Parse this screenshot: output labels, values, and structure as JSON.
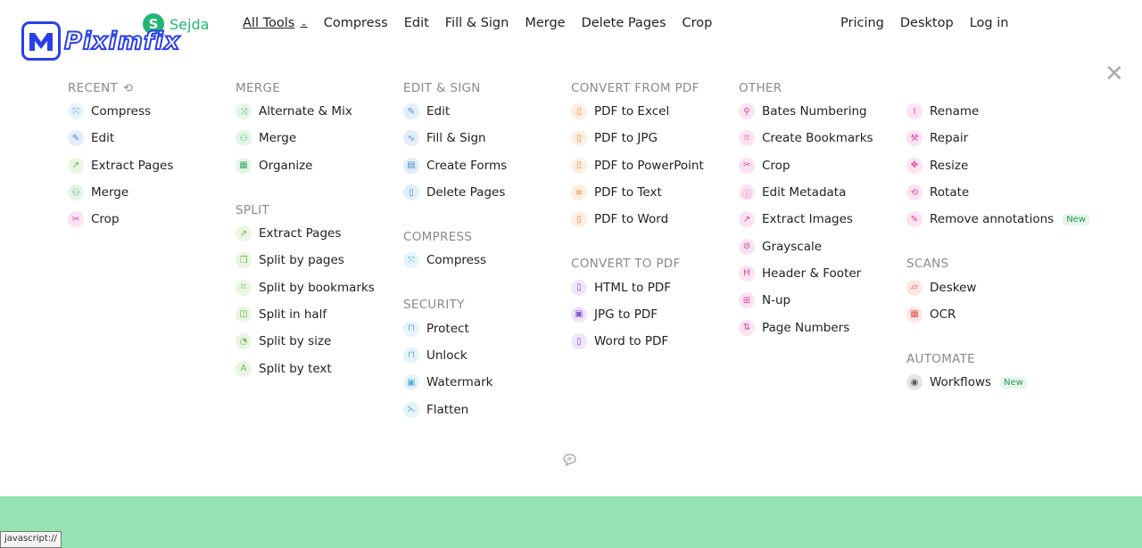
{
  "brand": {
    "sejda_letter": "S",
    "sejda_name": "Sejda",
    "piximfix": "Piximfix"
  },
  "nav": {
    "left": [
      "All Tools",
      "Compress",
      "Edit",
      "Fill & Sign",
      "Merge",
      "Delete Pages",
      "Crop"
    ],
    "right": [
      "Pricing",
      "Desktop",
      "Log in"
    ],
    "close": "✕"
  },
  "columns": [
    {
      "sections": [
        {
          "title": "RECENT",
          "items": [
            {
              "label": "Compress",
              "icon": "compress-icon",
              "glyph": "⤧",
              "color": "#e6f3fb",
              "fg": "#5aa9d6"
            },
            {
              "label": "Edit",
              "icon": "pencil-icon",
              "glyph": "✎",
              "color": "#e3eefb",
              "fg": "#4a8bd4"
            },
            {
              "label": "Extract Pages",
              "icon": "extract-icon",
              "glyph": "↗",
              "color": "#eaf6e3",
              "fg": "#6cb34a"
            },
            {
              "label": "Merge",
              "icon": "merge-icon",
              "glyph": "⚇",
              "color": "#e4f5ea",
              "fg": "#3fae6b"
            },
            {
              "label": "Crop",
              "icon": "crop-icon",
              "glyph": "✂",
              "color": "#fbe3f2",
              "fg": "#e0409b"
            }
          ]
        }
      ]
    },
    {
      "sections": [
        {
          "title": "MERGE",
          "items": [
            {
              "label": "Alternate & Mix",
              "icon": "shuffle-icon",
              "glyph": "⤨",
              "color": "#e4f5ea",
              "fg": "#3fae6b"
            },
            {
              "label": "Merge",
              "icon": "merge-icon",
              "glyph": "⚇",
              "color": "#e4f5ea",
              "fg": "#3fae6b"
            },
            {
              "label": "Organize",
              "icon": "grid-icon",
              "glyph": "▦",
              "color": "#e4f5ea",
              "fg": "#3fae6b"
            }
          ]
        },
        {
          "title": "SPLIT",
          "items": [
            {
              "label": "Extract Pages",
              "icon": "extract-icon",
              "glyph": "↗",
              "color": "#eaf6e3",
              "fg": "#6cb34a"
            },
            {
              "label": "Split by pages",
              "icon": "pages-icon",
              "glyph": "❐",
              "color": "#eaf6e3",
              "fg": "#6cb34a"
            },
            {
              "label": "Split by bookmarks",
              "icon": "bookmark-icon",
              "glyph": "⌑",
              "color": "#eaf6e3",
              "fg": "#6cb34a"
            },
            {
              "label": "Split in half",
              "icon": "half-icon",
              "glyph": "◫",
              "color": "#eaf6e3",
              "fg": "#6cb34a"
            },
            {
              "label": "Split by size",
              "icon": "size-icon",
              "glyph": "◔",
              "color": "#eaf6e3",
              "fg": "#6cb34a"
            },
            {
              "label": "Split by text",
              "icon": "text-icon",
              "glyph": "A",
              "color": "#eaf6e3",
              "fg": "#6cb34a"
            }
          ]
        }
      ]
    },
    {
      "sections": [
        {
          "title": "EDIT & SIGN",
          "items": [
            {
              "label": "Edit",
              "icon": "pencil-icon",
              "glyph": "✎",
              "color": "#e3eefb",
              "fg": "#4a8bd4"
            },
            {
              "label": "Fill & Sign",
              "icon": "signature-icon",
              "glyph": "∿",
              "color": "#e3eefb",
              "fg": "#4a8bd4"
            },
            {
              "label": "Create Forms",
              "icon": "form-icon",
              "glyph": "▤",
              "color": "#e3eefb",
              "fg": "#4a8bd4"
            },
            {
              "label": "Delete Pages",
              "icon": "trash-icon",
              "glyph": "▯",
              "color": "#e3eefb",
              "fg": "#4a8bd4"
            }
          ]
        },
        {
          "title": "COMPRESS",
          "items": [
            {
              "label": "Compress",
              "icon": "compress-icon",
              "glyph": "⤧",
              "color": "#e6f3fb",
              "fg": "#5aa9d6"
            }
          ]
        },
        {
          "title": "SECURITY",
          "items": [
            {
              "label": "Protect",
              "icon": "lock-icon",
              "glyph": "⊓",
              "color": "#e6f3fb",
              "fg": "#5aa9d6"
            },
            {
              "label": "Unlock",
              "icon": "unlock-icon",
              "glyph": "⊓",
              "color": "#e6f3fb",
              "fg": "#5aa9d6"
            },
            {
              "label": "Watermark",
              "icon": "watermark-icon",
              "glyph": "▣",
              "color": "#e6f3fb",
              "fg": "#5aa9d6"
            },
            {
              "label": "Flatten",
              "icon": "flatten-icon",
              "glyph": "⋋",
              "color": "#e6f3fb",
              "fg": "#5aa9d6"
            }
          ]
        }
      ]
    },
    {
      "sections": [
        {
          "title": "CONVERT FROM PDF",
          "items": [
            {
              "label": "PDF to Excel",
              "icon": "file-excel-icon",
              "glyph": "▯",
              "color": "#fdeee2",
              "fg": "#ef8a3a"
            },
            {
              "label": "PDF to JPG",
              "icon": "file-image-icon",
              "glyph": "▯",
              "color": "#fdeee2",
              "fg": "#ef8a3a"
            },
            {
              "label": "PDF to PowerPoint",
              "icon": "file-ppt-icon",
              "glyph": "▯",
              "color": "#fdeee2",
              "fg": "#ef8a3a"
            },
            {
              "label": "PDF to Text",
              "icon": "file-text-icon",
              "glyph": "≡",
              "color": "#fdeee2",
              "fg": "#ef8a3a"
            },
            {
              "label": "PDF to Word",
              "icon": "file-word-icon",
              "glyph": "▯",
              "color": "#fdeee2",
              "fg": "#ef8a3a"
            }
          ]
        },
        {
          "title": "CONVERT TO PDF",
          "items": [
            {
              "label": "HTML to PDF",
              "icon": "file-html-icon",
              "glyph": "▯",
              "color": "#efe6fb",
              "fg": "#8a53d6"
            },
            {
              "label": "JPG to PDF",
              "icon": "image-icon",
              "glyph": "▣",
              "color": "#efe6fb",
              "fg": "#8a53d6"
            },
            {
              "label": "Word to PDF",
              "icon": "file-doc-icon",
              "glyph": "▯",
              "color": "#efe6fb",
              "fg": "#8a53d6"
            }
          ]
        }
      ]
    },
    {
      "sections": [
        {
          "title": "OTHER",
          "items": [
            {
              "label": "Bates Numbering",
              "icon": "stamp-icon",
              "glyph": "⚲",
              "color": "#fbe3f2",
              "fg": "#e0409b"
            },
            {
              "label": "Create Bookmarks",
              "icon": "bookmark-icon",
              "glyph": "⌑",
              "color": "#fbe3f2",
              "fg": "#e0409b"
            },
            {
              "label": "Crop",
              "icon": "crop-icon",
              "glyph": "✂",
              "color": "#fbe3f2",
              "fg": "#e0409b"
            },
            {
              "label": "Edit Metadata",
              "icon": "info-icon",
              "glyph": "ⓘ",
              "color": "#fbe3f2",
              "fg": "#e0409b"
            },
            {
              "label": "Extract Images",
              "icon": "extract-icon",
              "glyph": "↗",
              "color": "#fbe3f2",
              "fg": "#e0409b"
            },
            {
              "label": "Grayscale",
              "icon": "dropper-icon",
              "glyph": "⊘",
              "color": "#fbe3f2",
              "fg": "#e0409b"
            },
            {
              "label": "Header & Footer",
              "icon": "header-icon",
              "glyph": "H",
              "color": "#fbe3f2",
              "fg": "#e0409b"
            },
            {
              "label": "N-up",
              "icon": "grid-icon",
              "glyph": "⊞",
              "color": "#fbe3f2",
              "fg": "#e0409b"
            },
            {
              "label": "Page Numbers",
              "icon": "numbers-icon",
              "glyph": "⇅",
              "color": "#fbe3f2",
              "fg": "#e0409b"
            }
          ]
        }
      ]
    },
    {
      "sections": [
        {
          "title": "",
          "items": [
            {
              "label": "Rename",
              "icon": "cursor-icon",
              "glyph": "I",
              "color": "#fbe3f2",
              "fg": "#e0409b"
            },
            {
              "label": "Repair",
              "icon": "wrench-icon",
              "glyph": "⚒",
              "color": "#fbe3f2",
              "fg": "#e0409b"
            },
            {
              "label": "Resize",
              "icon": "resize-icon",
              "glyph": "✥",
              "color": "#fbe3f2",
              "fg": "#e0409b"
            },
            {
              "label": "Rotate",
              "icon": "rotate-icon",
              "glyph": "⟲",
              "color": "#fbe3f2",
              "fg": "#e0409b"
            },
            {
              "label": "Remove annotations",
              "icon": "eraser-icon",
              "glyph": "✎",
              "color": "#fbe3f2",
              "fg": "#e0409b",
              "badge": "New"
            }
          ]
        },
        {
          "title": "SCANS",
          "items": [
            {
              "label": "Deskew",
              "icon": "deskew-icon",
              "glyph": "▱",
              "color": "#fde6e6",
              "fg": "#e05050"
            },
            {
              "label": "OCR",
              "icon": "ocr-icon",
              "glyph": "▦",
              "color": "#fde6e6",
              "fg": "#e05050"
            }
          ]
        },
        {
          "title": "AUTOMATE",
          "items": [
            {
              "label": "Workflows",
              "icon": "robot-icon",
              "glyph": "◉",
              "color": "#e5e5e5",
              "fg": "#555",
              "badge": "New"
            }
          ]
        }
      ]
    }
  ],
  "status_tip": "javascript://"
}
